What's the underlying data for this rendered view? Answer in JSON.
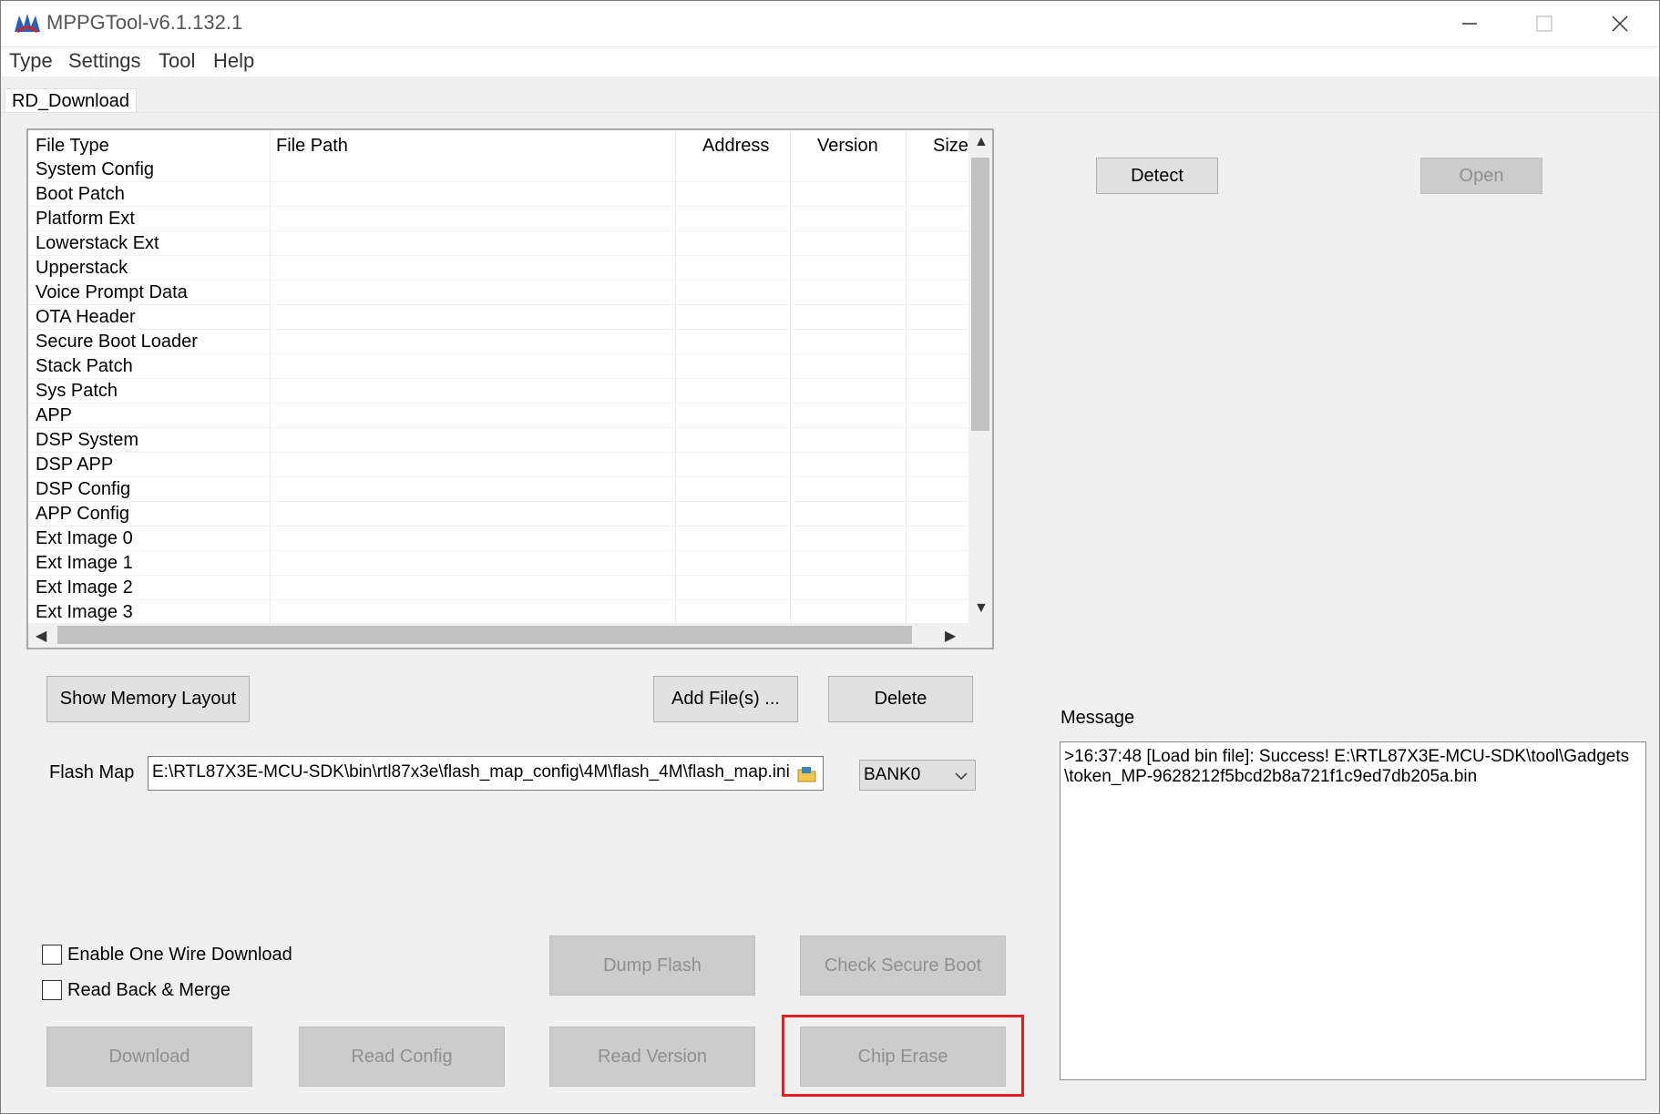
{
  "window": {
    "title": "MPPGTool-v6.1.132.1"
  },
  "menu": [
    "Type",
    "Settings",
    "Tool",
    "Help"
  ],
  "tab": "RD_Download",
  "table": {
    "columns": [
      "File Type",
      "File Path",
      "Address",
      "Version",
      "Size"
    ],
    "rows": [
      "System Config",
      "Boot Patch",
      "Platform Ext",
      "Lowerstack Ext",
      "Upperstack",
      "Voice Prompt Data",
      "OTA Header",
      "Secure Boot Loader",
      "Stack Patch",
      "Sys Patch",
      "APP",
      "DSP System",
      "DSP APP",
      "DSP Config",
      "APP Config",
      "Ext Image 0",
      "Ext Image 1",
      "Ext Image 2",
      "Ext Image 3"
    ]
  },
  "buttons": {
    "detect": "Detect",
    "open": "Open",
    "show_memory_layout": "Show Memory Layout",
    "add_files": "Add File(s) ...",
    "delete": "Delete",
    "dump_flash": "Dump Flash",
    "check_secure_boot": "Check Secure Boot",
    "download": "Download",
    "read_config": "Read Config",
    "read_version": "Read Version",
    "chip_erase": "Chip Erase"
  },
  "flash_map": {
    "label": "Flash Map",
    "path": "E:\\RTL87X3E-MCU-SDK\\bin\\rtl87x3e\\flash_map_config\\4M\\flash_4M\\flash_map.ini",
    "bank": "BANK0"
  },
  "options": {
    "one_wire": "Enable One Wire Download",
    "read_back": "Read Back & Merge"
  },
  "message": {
    "label": "Message",
    "line1": ">16:37:48    [Load bin file]: Success! E:\\RTL87X3E-MCU-SDK\\tool\\Gadgets",
    "line2": "\\token_MP-9628212f5bcd2b8a721f1c9ed7db205a.bin"
  },
  "colors": {
    "highlight": "#e02020",
    "disabled_text": "#8f8f8f"
  },
  "icons": [
    "app-logo-icon",
    "minimize-icon",
    "maximize-icon",
    "close-icon",
    "folder-browse-icon",
    "chevron-down-icon"
  ]
}
